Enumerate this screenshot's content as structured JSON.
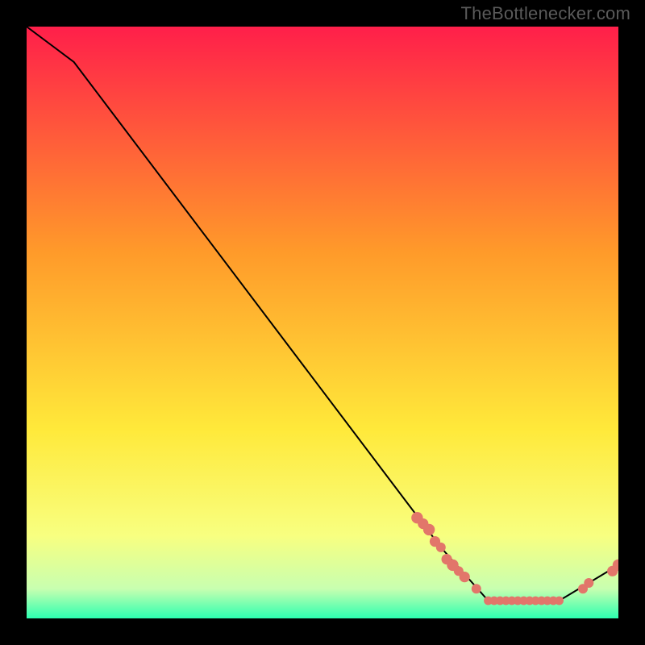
{
  "watermark": "TheBottlenecker.com",
  "colors": {
    "top": "#ff1f4a",
    "mid1": "#ff9a2a",
    "mid2": "#ffe93a",
    "low1": "#f8ff80",
    "low2": "#c8ffb0",
    "bottom": "#2dffb0",
    "curve": "#000000",
    "marker": "#e2766a"
  },
  "chart_data": {
    "type": "line",
    "title": "",
    "xlabel": "",
    "ylabel": "",
    "xlim": [
      0,
      100
    ],
    "ylim": [
      0,
      100
    ],
    "x": [
      0,
      4,
      8,
      70,
      78,
      90,
      100
    ],
    "y": [
      100,
      97,
      94,
      12,
      3,
      3,
      9
    ],
    "markers": [
      {
        "x": 66,
        "y": 17,
        "r": 1.2
      },
      {
        "x": 67,
        "y": 16,
        "r": 1.1
      },
      {
        "x": 68,
        "y": 15,
        "r": 1.2
      },
      {
        "x": 69,
        "y": 13,
        "r": 1.1
      },
      {
        "x": 70,
        "y": 12,
        "r": 1.0
      },
      {
        "x": 71,
        "y": 10,
        "r": 1.1
      },
      {
        "x": 72,
        "y": 9,
        "r": 1.2
      },
      {
        "x": 73,
        "y": 8,
        "r": 1.0
      },
      {
        "x": 74,
        "y": 7,
        "r": 1.1
      },
      {
        "x": 76,
        "y": 5,
        "r": 1.0
      },
      {
        "x": 78,
        "y": 3,
        "r": 0.9
      },
      {
        "x": 79,
        "y": 3,
        "r": 0.9
      },
      {
        "x": 80,
        "y": 3,
        "r": 0.9
      },
      {
        "x": 81,
        "y": 3,
        "r": 0.9
      },
      {
        "x": 82,
        "y": 3,
        "r": 0.9
      },
      {
        "x": 83,
        "y": 3,
        "r": 0.9
      },
      {
        "x": 84,
        "y": 3,
        "r": 0.9
      },
      {
        "x": 85,
        "y": 3,
        "r": 0.9
      },
      {
        "x": 86,
        "y": 3,
        "r": 0.9
      },
      {
        "x": 87,
        "y": 3,
        "r": 0.9
      },
      {
        "x": 88,
        "y": 3,
        "r": 0.9
      },
      {
        "x": 89,
        "y": 3,
        "r": 0.9
      },
      {
        "x": 90,
        "y": 3,
        "r": 0.9
      },
      {
        "x": 94,
        "y": 5,
        "r": 1.0
      },
      {
        "x": 95,
        "y": 6,
        "r": 1.0
      },
      {
        "x": 99,
        "y": 8,
        "r": 1.1
      },
      {
        "x": 100,
        "y": 9,
        "r": 1.2
      }
    ]
  }
}
